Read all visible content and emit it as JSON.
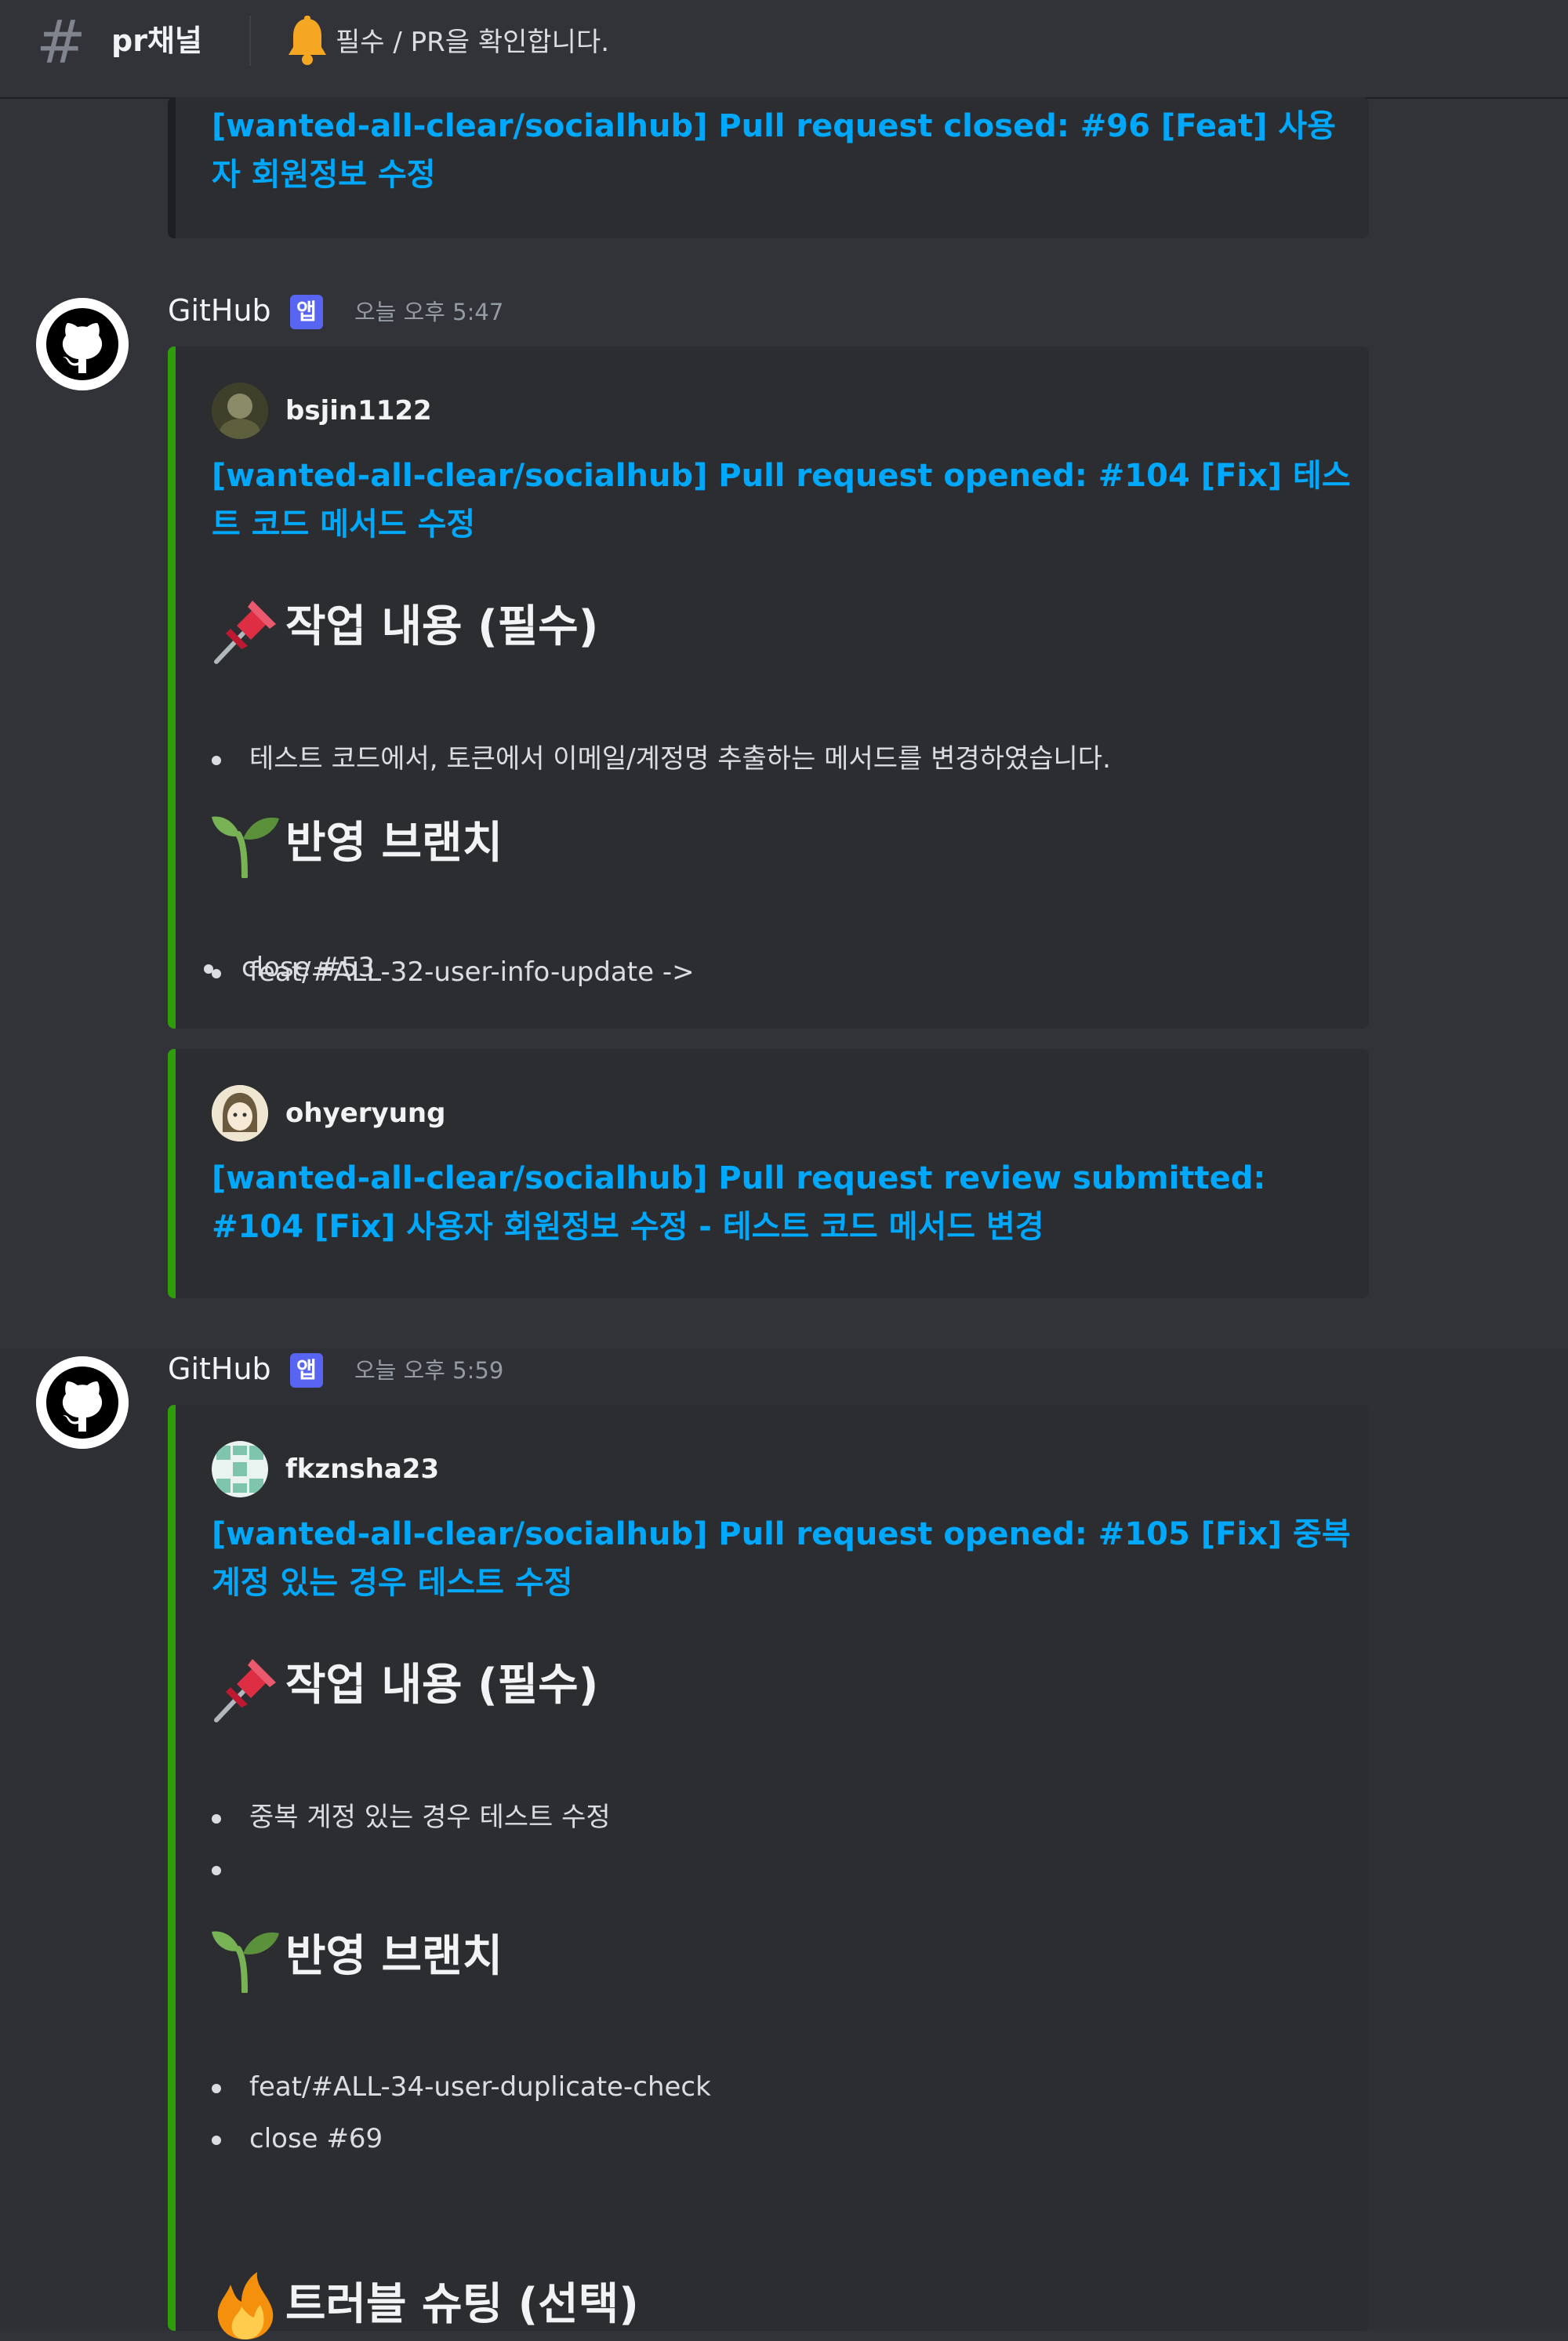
{
  "header": {
    "channel_icon": "hash-icon",
    "channel_name": "pr채널",
    "topic_icon": "bell-icon",
    "topic": "필수 / PR을 확인합니다."
  },
  "colors": {
    "embed_bar": "#2f9c0a",
    "link": "#00a8fc",
    "app_badge": "#5865f2",
    "background": "#313338"
  },
  "messages": [
    {
      "partial_embed_title": "[wanted-all-clear/socialhub] Pull request closed: #96 [Feat] 사용자 회원정보 수정"
    },
    {
      "author": "GitHub",
      "badge": "앱",
      "timestamp": "오늘 오후 5:47",
      "embeds": [
        {
          "user": "bsjin1122",
          "title": "[wanted-all-clear/socialhub] Pull request opened: #104 [Fix] 테스트 코드 메서드 수정",
          "sections": [
            {
              "emoji": "pushpin-icon",
              "heading": "작업 내용 (필수)",
              "items": [
                "테스트 코드에서, 토큰에서 이메일/계정명 추출하는 메서드를 변경하였습니다."
              ]
            },
            {
              "emoji": "seedling-icon",
              "heading": "반영 브랜치",
              "items": [
                "feat/#ALL-32-user-info-update ->",
                "close #53"
              ]
            }
          ]
        },
        {
          "user": "ohyeryung",
          "title": "[wanted-all-clear/socialhub] Pull request review submitted: #104 [Fix] 사용자 회원정보 수정 - 테스트 코드 메서드 변경"
        }
      ]
    },
    {
      "author": "GitHub",
      "badge": "앱",
      "timestamp": "오늘 오후 5:59",
      "embeds": [
        {
          "user": "fkznsha23",
          "title": "[wanted-all-clear/socialhub] Pull request opened: #105 [Fix] 중복 계정 있는 경우 테스트 수정",
          "sections": [
            {
              "emoji": "pushpin-icon",
              "heading": "작업 내용 (필수)",
              "items": [
                "중복 계정 있는 경우 테스트 수정",
                ""
              ]
            },
            {
              "emoji": "seedling-icon",
              "heading": "반영 브랜치",
              "items": [
                "feat/#ALL-34-user-duplicate-check",
                "close #69"
              ]
            },
            {
              "emoji": "fire-icon",
              "heading": "트러블 슈팅 (선택)",
              "items": []
            }
          ]
        }
      ]
    }
  ]
}
